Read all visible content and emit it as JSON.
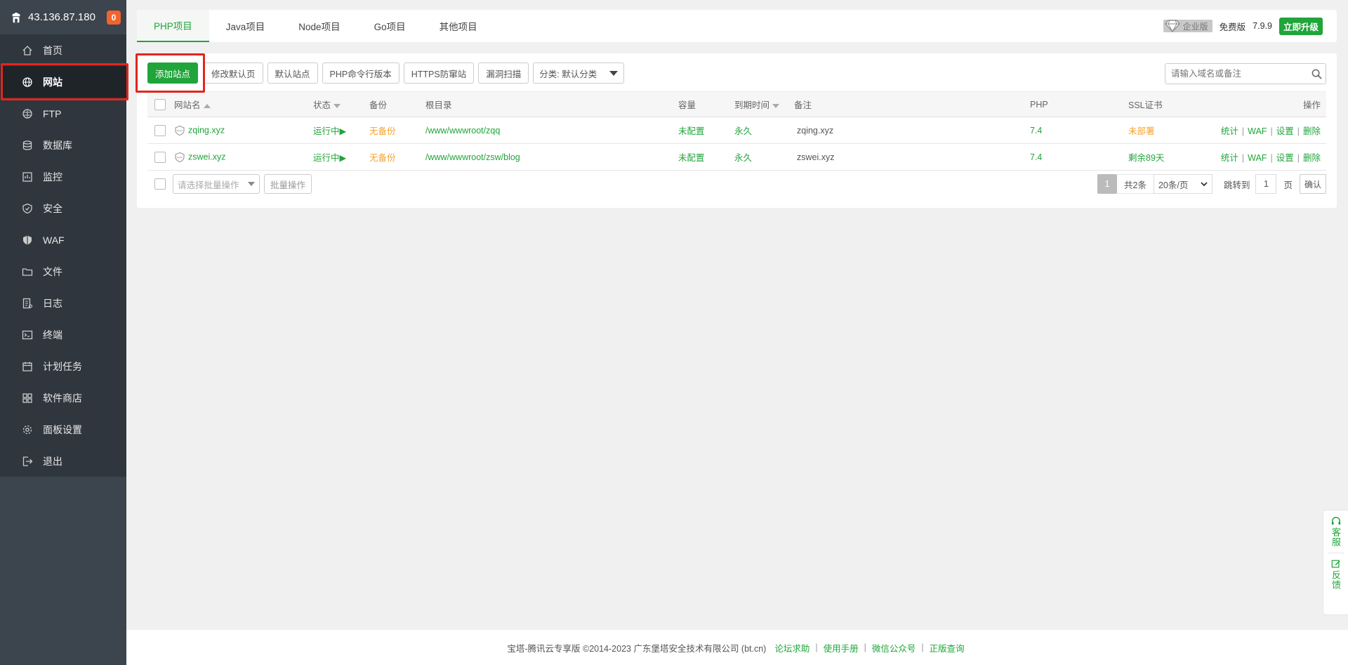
{
  "sidebar": {
    "ip": "43.136.87.180",
    "badge": "0",
    "items": [
      {
        "label": "首页",
        "icon": "home-icon"
      },
      {
        "label": "网站",
        "icon": "globe-icon"
      },
      {
        "label": "FTP",
        "icon": "ftp-icon"
      },
      {
        "label": "数据库",
        "icon": "database-icon"
      },
      {
        "label": "监控",
        "icon": "monitor-icon"
      },
      {
        "label": "安全",
        "icon": "shield-icon"
      },
      {
        "label": "WAF",
        "icon": "waf-shield-icon"
      },
      {
        "label": "文件",
        "icon": "folder-icon"
      },
      {
        "label": "日志",
        "icon": "log-icon"
      },
      {
        "label": "终端",
        "icon": "terminal-icon"
      },
      {
        "label": "计划任务",
        "icon": "calendar-icon"
      },
      {
        "label": "软件商店",
        "icon": "apps-icon"
      },
      {
        "label": "面板设置",
        "icon": "gear-icon"
      },
      {
        "label": "退出",
        "icon": "logout-icon"
      }
    ],
    "active_index": 1
  },
  "tabs": [
    "PHP项目",
    "Java项目",
    "Node项目",
    "Go项目",
    "其他项目"
  ],
  "header_right": {
    "edition": "企业版",
    "free": "免费版",
    "version": "7.9.9",
    "upgrade": "立即升级"
  },
  "toolbar": {
    "add_site": "添加站点",
    "modify_default": "修改默认页",
    "default_site": "默认站点",
    "php_cli": "PHP命令行版本",
    "https_guard": "HTTPS防窜站",
    "vuln_scan": "漏洞扫描",
    "category": "分类: 默认分类",
    "search_placeholder": "请输入域名或备注"
  },
  "table": {
    "headers": [
      "网站名",
      "状态",
      "备份",
      "根目录",
      "容量",
      "到期时间",
      "备注",
      "PHP",
      "SSL证书",
      "操作"
    ],
    "rows": [
      {
        "name": "zqing.xyz",
        "status": "运行中▶",
        "backup": "无备份",
        "root": "/www/wwwroot/zqq",
        "quota": "未配置",
        "expire": "永久",
        "remark": "zqing.xyz",
        "php": "7.4",
        "ssl": "未部署",
        "ssl_color": "#f7a22e"
      },
      {
        "name": "zswei.xyz",
        "status": "运行中▶",
        "backup": "无备份",
        "root": "/www/wwwroot/zsw/blog",
        "quota": "未配置",
        "expire": "永久",
        "remark": "zswei.xyz",
        "php": "7.4",
        "ssl": "剩余89天",
        "ssl_color": "#20a53a"
      }
    ],
    "actions": [
      "统计",
      "WAF",
      "设置",
      "删除"
    ]
  },
  "batch": {
    "select_placeholder": "请选择批量操作",
    "button": "批量操作"
  },
  "pager": {
    "current": "1",
    "total": "共2条",
    "page_size": "20条/页",
    "jump_label": "跳转到",
    "jump_value": "1",
    "page_unit": "页",
    "confirm": "确认"
  },
  "footer": {
    "copyright": "宝塔-腾讯云专享版 ©2014-2023 广东堡塔安全技术有限公司 (bt.cn)",
    "links": [
      "论坛求助",
      "使用手册",
      "微信公众号",
      "正版查询"
    ]
  },
  "float": {
    "service": "客服",
    "feedback": "反馈"
  }
}
